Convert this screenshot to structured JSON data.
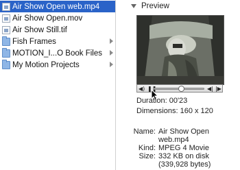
{
  "file_list": {
    "items": [
      {
        "label": "Air Show Open web.mp4",
        "type": "file",
        "selected": true,
        "icon": "document-icon"
      },
      {
        "label": "Air Show Open.mov",
        "type": "file",
        "selected": false,
        "icon": "document-icon"
      },
      {
        "label": "Air Show Still.tif",
        "type": "file",
        "selected": false,
        "icon": "document-icon"
      },
      {
        "label": "Fish Frames",
        "type": "folder",
        "selected": false,
        "icon": "folder-icon"
      },
      {
        "label": "MOTION_I...O Book Files",
        "type": "folder",
        "selected": false,
        "icon": "folder-icon"
      },
      {
        "label": "My Motion Projects",
        "type": "folder",
        "selected": false,
        "icon": "folder-icon"
      }
    ]
  },
  "preview": {
    "header": "Preview",
    "player": {
      "position_fraction": 0.55,
      "volume_icon": "speaker-icon",
      "pause_icon": "pause-icon",
      "step_back_icon": "step-back-icon",
      "step_forward_icon": "step-forward-icon"
    },
    "duration_label": "Duration:",
    "duration_value": "00'23",
    "dimensions_label": "Dimensions:",
    "dimensions_value": "160 x 120",
    "name_label": "Name:",
    "name_value_line1": "Air Show Open",
    "name_value_line2": "web.mp4",
    "kind_label": "Kind:",
    "kind_value": "MPEG 4 Movie",
    "size_label": "Size:",
    "size_value_line1": "332 KB on disk",
    "size_value_line2": "(339,928 bytes)"
  },
  "colors": {
    "selection": "#2a63c8",
    "folder": "#8fb6e6"
  }
}
